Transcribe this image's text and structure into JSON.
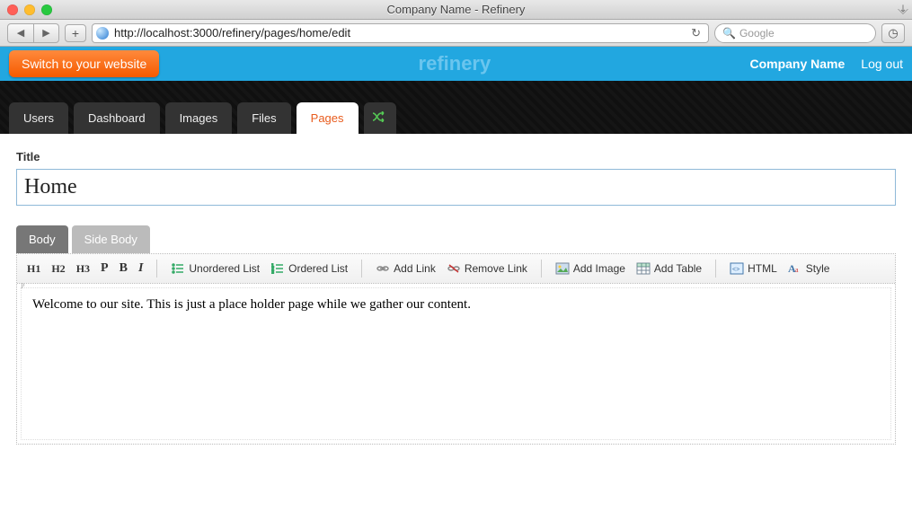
{
  "window": {
    "title": "Company Name - Refinery"
  },
  "browser": {
    "url": "http://localhost:3000/refinery/pages/home/edit",
    "search_placeholder": "Google"
  },
  "header": {
    "switch_label": "Switch to your website",
    "brand": "refinery",
    "company": "Company Name",
    "logout": "Log out"
  },
  "nav": {
    "tabs": [
      "Users",
      "Dashboard",
      "Images",
      "Files",
      "Pages"
    ],
    "active_index": 4
  },
  "page": {
    "title_label": "Title",
    "title_value": "Home",
    "body_tabs": [
      "Body",
      "Side Body"
    ],
    "body_tab_active": 0,
    "editor_text": "Welcome to our site. This is just a place holder page while we gather our content."
  },
  "toolbar": {
    "h1": "H1",
    "h2": "H2",
    "h3": "H3",
    "p": "P",
    "b": "B",
    "i": "I",
    "ul": "Unordered List",
    "ol": "Ordered List",
    "addlink": "Add Link",
    "removelink": "Remove Link",
    "addimage": "Add Image",
    "addtable": "Add Table",
    "html": "HTML",
    "style": "Style"
  }
}
